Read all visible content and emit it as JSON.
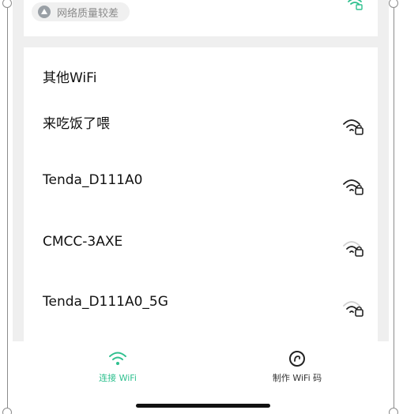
{
  "top_card": {
    "quality_label": "网络质量较差",
    "wifi_icon": "wifi-lock-icon",
    "accent": "#2fc08f"
  },
  "other_wifi": {
    "title": "其他WiFi",
    "networks": [
      {
        "name": "来吃饭了喂",
        "icon": "wifi-lock-icon"
      },
      {
        "name": "Tenda_D111A0",
        "icon": "wifi-lock-icon"
      },
      {
        "name": "CMCC-3AXE",
        "icon": "wifi-lock-icon"
      },
      {
        "name": "Tenda_D111A0_5G",
        "icon": "wifi-lock-icon"
      }
    ]
  },
  "bottom_nav": {
    "connect_label": "连接 WiFi",
    "make_label": "制作 WiFi 码",
    "active_color": "#2fc08f"
  }
}
